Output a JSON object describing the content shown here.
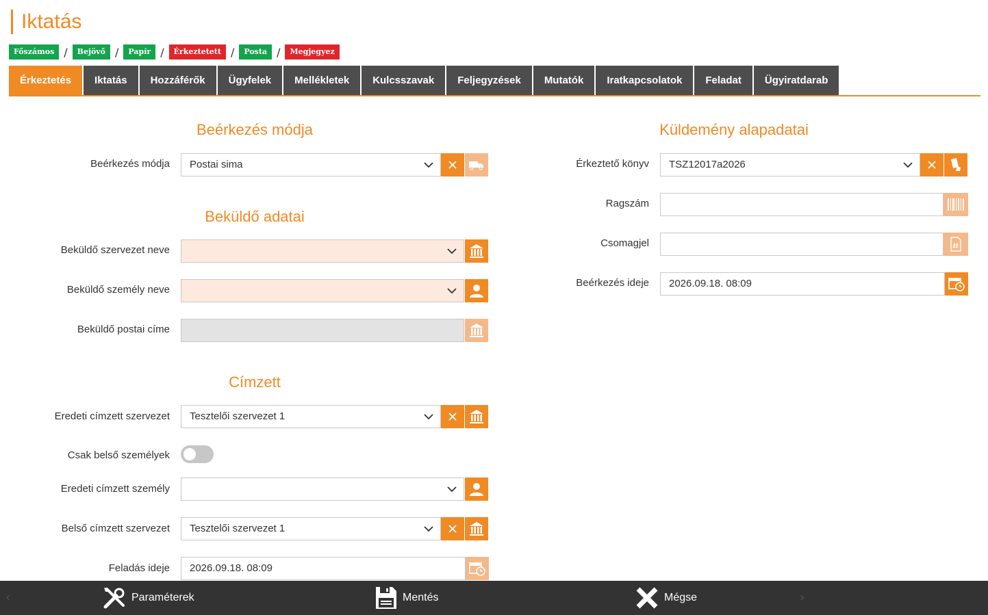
{
  "page_title": "Iktatás",
  "breadcrumb": [
    {
      "label": "Főszámos",
      "color": "#14a44d"
    },
    {
      "label": "Bejövő",
      "color": "#14a44d"
    },
    {
      "label": "Papír",
      "color": "#14a44d"
    },
    {
      "label": "Érkeztetett",
      "color": "#e0262c"
    },
    {
      "label": "Posta",
      "color": "#14a44d"
    },
    {
      "label": "Megjegyez",
      "color": "#e0262c"
    }
  ],
  "breadcrumb_separator": "/",
  "tabs": [
    {
      "label": "Érkeztetés",
      "active": true
    },
    {
      "label": "Iktatás"
    },
    {
      "label": "Hozzáférők"
    },
    {
      "label": "Ügyfelek"
    },
    {
      "label": "Mellékletek"
    },
    {
      "label": "Kulcsszavak"
    },
    {
      "label": "Feljegyzések"
    },
    {
      "label": "Mutatók"
    },
    {
      "label": "Iratkapcsolatok"
    },
    {
      "label": "Feladat"
    },
    {
      "label": "Ügyiratdarab"
    }
  ],
  "left": {
    "section_arrival": "Beérkezés módja",
    "arrival_mode_label": "Beérkezés módja",
    "arrival_mode_value": "Postai sima",
    "section_sender": "Beküldő adatai",
    "sender_org_label": "Beküldő szervezet neve",
    "sender_org_value": "",
    "sender_person_label": "Beküldő személy neve",
    "sender_person_value": "",
    "sender_address_label": "Beküldő postai címe",
    "sender_address_value": "",
    "section_recipient": "Címzett",
    "orig_recipient_org_label": "Eredeti címzett szervezet",
    "orig_recipient_org_value": "Tesztelői szervezet 1",
    "internal_only_label": "Csak belső személyek",
    "internal_only_on": false,
    "orig_recipient_person_label": "Eredeti címzett személy",
    "orig_recipient_person_value": "",
    "internal_recipient_org_label": "Belső címzett szervezet",
    "internal_recipient_org_value": "Tesztelői szervezet 1",
    "sent_time_label": "Feladás ideje",
    "sent_time_value": "2026.09.18. 08:09"
  },
  "right": {
    "section_shipment": "Küldemény alapadatai",
    "register_book_label": "Érkeztető könyv",
    "register_book_value": "TSZ12017a2026",
    "tracking_label": "Ragszám",
    "tracking_value": "",
    "package_label": "Csomagjel",
    "package_value": "",
    "arrival_time_label": "Beérkezés ideje",
    "arrival_time_value": "2026.09.18. 08:09"
  },
  "footer": {
    "params_label": "Paraméterek",
    "save_label": "Mentés",
    "cancel_label": "Mégse"
  },
  "colors": {
    "accent": "#f08a24",
    "tab_bg": "#4d4d4d",
    "footer_bg": "#333333"
  }
}
